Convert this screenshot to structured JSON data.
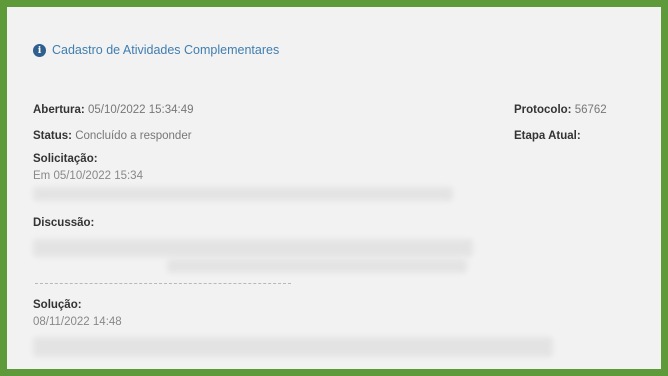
{
  "header": {
    "icon": "info-icon",
    "title": "Cadastro de Atividades Complementares"
  },
  "details": {
    "abertura_label": "Abertura:",
    "abertura_value": "05/10/2022 15:34:49",
    "status_label": "Status:",
    "status_value": "Concluído a responder",
    "protocolo_label": "Protocolo:",
    "protocolo_value": "56762",
    "etapa_label": "Etapa Atual:",
    "etapa_value": ""
  },
  "solicitacao": {
    "label": "Solicitação:",
    "date": "Em 05/10/2022 15:34"
  },
  "discussao": {
    "label": "Discussão:"
  },
  "solucao": {
    "label": "Solução:",
    "date": "08/11/2022 14:48"
  },
  "colors": {
    "border": "#5f9a3a",
    "background": "#f2f2f2",
    "link": "#3f7eb0"
  }
}
